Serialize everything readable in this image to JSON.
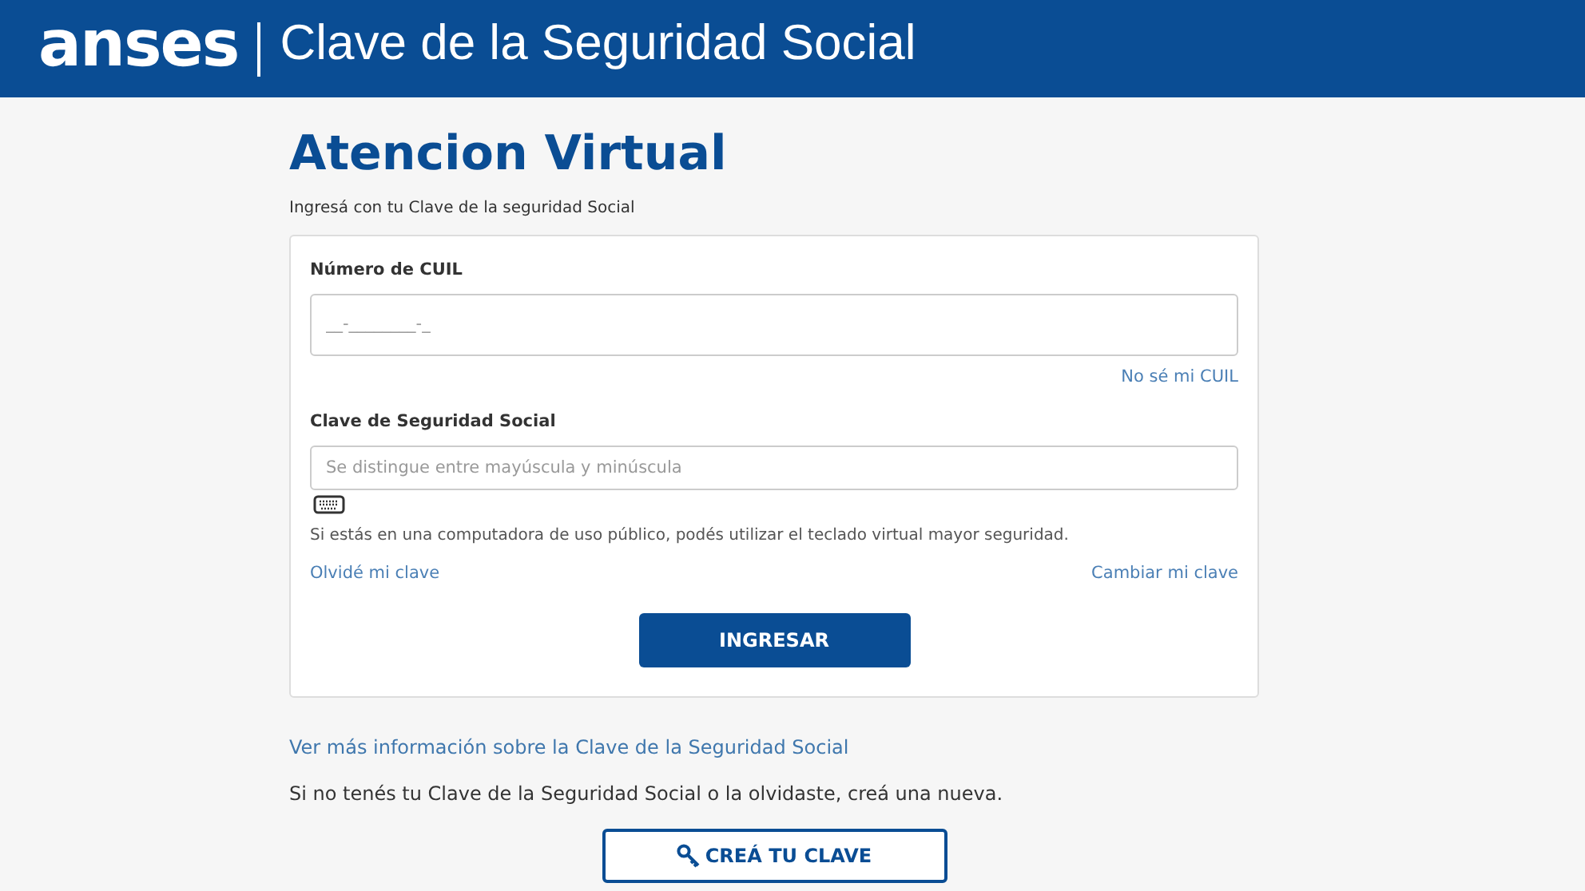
{
  "header": {
    "logo": "anses",
    "title": "Clave de la Seguridad Social"
  },
  "page": {
    "title": "Atencion Virtual",
    "subtitle": "Ingresá con tu Clave de la seguridad Social"
  },
  "form": {
    "cuil": {
      "label": "Número de CUIL",
      "placeholder": "__-________-_",
      "help_link": "No sé mi CUIL"
    },
    "password": {
      "label": "Clave de Seguridad Social",
      "placeholder": "Se distingue entre mayúscula y minúscula"
    },
    "notice": "Si estás en una computadora de uso público, podés utilizar el teclado virtual mayor seguridad.",
    "links": [
      "Olvidé mi clave",
      "Cambiar mi clave"
    ],
    "submit": "INGRESAR"
  },
  "info_link": "Ver más información sobre la Clave de la Seguridad Social",
  "create_text": "Si no tenés tu Clave de la Seguridad Social o la olvidaste, creá una nueva.",
  "create_button": "CREÁ TU CLAVE"
}
